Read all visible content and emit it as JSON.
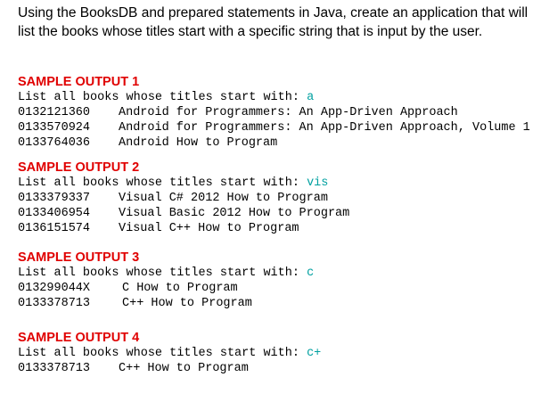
{
  "intro": "Using the BooksDB and prepared statements in Java, create an application that will list the books whose titles start with a specific string that is input by the user.",
  "samples": [
    {
      "heading": "SAMPLE OUTPUT 1",
      "prompt": "List all books whose titles start with: ",
      "input": "a",
      "rows": [
        {
          "isbn": "0132121360",
          "title": "Android for Programmers: An App-Driven Approach"
        },
        {
          "isbn": "0133570924",
          "title": "Android for Programmers: An App-Driven Approach, Volume 1"
        },
        {
          "isbn": "0133764036",
          "title": "Android How to Program"
        }
      ]
    },
    {
      "heading": "SAMPLE OUTPUT 2",
      "prompt": "List all books whose titles start with: ",
      "input": "vis",
      "rows": [
        {
          "isbn": "0133379337",
          "title": "Visual C# 2012 How to Program"
        },
        {
          "isbn": "0133406954",
          "title": "Visual Basic 2012 How to Program"
        },
        {
          "isbn": "0136151574",
          "title": "Visual C++ How to Program"
        }
      ]
    },
    {
      "heading": "SAMPLE OUTPUT 3",
      "prompt": "List all books whose titles start with: ",
      "input": "c",
      "rows": [
        {
          "isbn": "013299044X",
          "title": "C How to Program"
        },
        {
          "isbn": "0133378713",
          "title": "C++ How to Program"
        }
      ]
    },
    {
      "heading": "SAMPLE OUTPUT 4",
      "prompt": "List all books whose titles start with: ",
      "input": "c+",
      "rows": [
        {
          "isbn": "0133378713",
          "title": "C++ How to Program"
        }
      ]
    }
  ]
}
